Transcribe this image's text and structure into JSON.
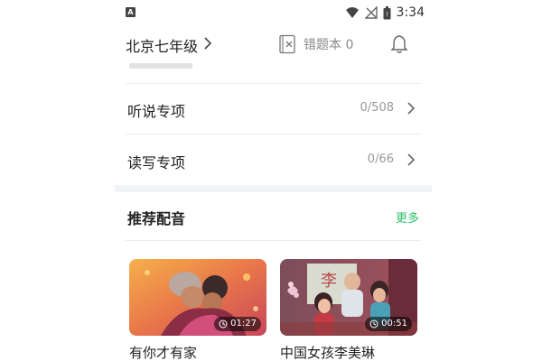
{
  "status_bar": {
    "left_icon": "A",
    "time": "3:34",
    "icons": [
      "wifi-icon",
      "no-signal-icon",
      "battery-icon"
    ]
  },
  "header": {
    "city": "北京七年级",
    "mistake_book": "错题本 0",
    "icons": [
      "mistake-book-icon",
      "bell-icon"
    ]
  },
  "list_items": [
    {
      "title": "听说专项",
      "count": "0/508"
    },
    {
      "title": "读写专项",
      "count": "0/66"
    }
  ],
  "section": {
    "title": "推荐配音",
    "more": "更多"
  },
  "cards": [
    {
      "title": "有你才有家",
      "duration": "01:27"
    },
    {
      "title": "中国女孩李美琳",
      "duration": "00:51"
    }
  ],
  "colors": {
    "accent_green": "#2cbf6a",
    "divider_band": "#f1f3f6",
    "muted_text": "#999999"
  }
}
